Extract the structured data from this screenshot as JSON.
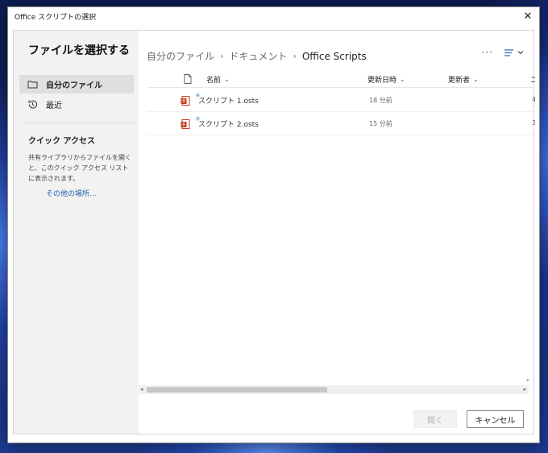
{
  "window": {
    "title": "Office スクリプトの選択"
  },
  "sidebar": {
    "heading": "ファイルを選択する",
    "items": [
      {
        "label": "自分のファイル",
        "icon": "folder-icon",
        "selected": true
      },
      {
        "label": "最近",
        "icon": "history-icon",
        "selected": false
      }
    ],
    "quick_access": {
      "title": "クイック アクセス",
      "description": "共有ライブラリからファイルを開くと、このクイック アクセス リストに表示されます。",
      "more_link": "その他の場所..."
    }
  },
  "breadcrumb": {
    "items": [
      "自分のファイル",
      "ドキュメント"
    ],
    "current": "Office Scripts"
  },
  "table": {
    "columns": {
      "name": "名前",
      "modified": "更新日時",
      "modified_by": "更新者"
    },
    "rows": [
      {
        "name": "スクリプト 1.osts",
        "modified": "18 分前",
        "extra": "4"
      },
      {
        "name": "スクリプト 2.osts",
        "modified": "15 分前",
        "extra": "3"
      }
    ]
  },
  "buttons": {
    "open": "開く",
    "cancel": "キャンセル"
  },
  "colors": {
    "accent": "#1f5fb5",
    "file_icon": "#c43e1c",
    "sidebar_bg": "#f3f2f1"
  }
}
